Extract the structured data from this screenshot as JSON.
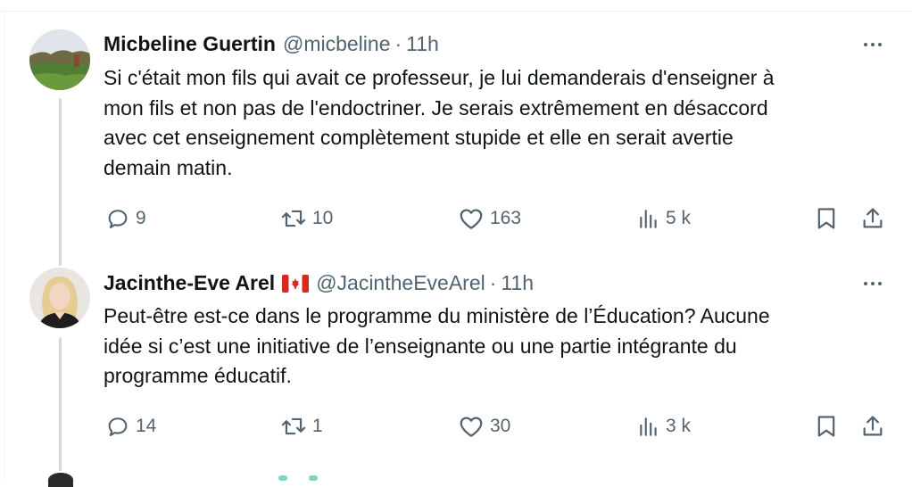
{
  "tweets": [
    {
      "name": "Micbeline Guertin",
      "handle": "@micbeline",
      "separator": "·",
      "time": "11h",
      "text": "Si c'était mon fils qui avait ce professeur, je lui demanderais d'enseigner à\nmon fils et non pas de l'endoctriner. Je serais extrêmement en désaccord\navec cet enseignement complètement stupide et elle en serait avertie\ndemain matin.",
      "replies": "9",
      "retweets": "10",
      "likes": "163",
      "views": "5 k",
      "avatar_icon": "landscape-avatar"
    },
    {
      "name": "Jacinthe-Eve Arel",
      "flag_icon": "canada-flag-icon",
      "handle": "@JacintheEveArel",
      "separator": "·",
      "time": "11h",
      "text": "Peut-être est-ce dans le programme du ministère de l’Éducation? Aucune\nidée si c’est une initiative de l’enseignante ou une partie intégrante du\nprogramme éducatif.",
      "replies": "14",
      "retweets": "1",
      "likes": "30",
      "views": "3 k",
      "avatar_icon": "person-avatar"
    }
  ],
  "colors": {
    "text": "#0f1419",
    "muted": "#536471",
    "divider": "#eff3f4",
    "thread_line": "#cfd9de"
  }
}
